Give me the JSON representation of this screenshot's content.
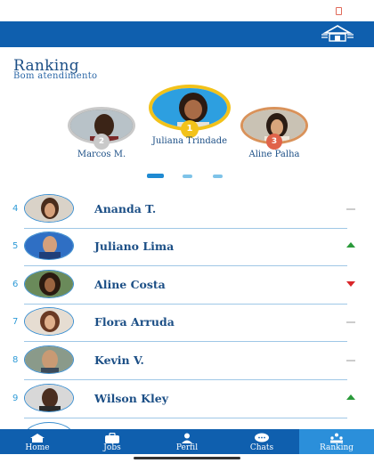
{
  "header": {
    "logo_icon": "house-logo-icon"
  },
  "ranking": {
    "title": "Ranking",
    "subtitle": "Bom atendimento"
  },
  "podium": [
    {
      "position": "2",
      "name": "Marcos M.",
      "medal": "silver-medal-icon"
    },
    {
      "position": "1",
      "name": "Juliana Trindade",
      "medal": "gold-medal-icon"
    },
    {
      "position": "3",
      "name": "Aline Palha",
      "medal": "bronze-medal-icon"
    }
  ],
  "pager": {
    "pages": 3,
    "active_index": 0
  },
  "list": [
    {
      "position": "4",
      "name": "Ananda T.",
      "trend": "neutral"
    },
    {
      "position": "5",
      "name": "Juliano Lima",
      "trend": "up"
    },
    {
      "position": "6",
      "name": "Aline Costa",
      "trend": "down"
    },
    {
      "position": "7",
      "name": "Flora Arruda",
      "trend": "neutral"
    },
    {
      "position": "8",
      "name": "Kevin V.",
      "trend": "neutral"
    },
    {
      "position": "9",
      "name": "Wilson Kley",
      "trend": "up"
    }
  ],
  "nav": [
    {
      "label": "Home",
      "icon": "home-icon",
      "active": false
    },
    {
      "label": "Jobs",
      "icon": "briefcase-icon",
      "active": false
    },
    {
      "label": "Perfil",
      "icon": "user-icon",
      "active": false
    },
    {
      "label": "Chats",
      "icon": "chat-icon",
      "active": false
    },
    {
      "label": "Ranking",
      "icon": "ranking-icon",
      "active": true
    }
  ],
  "colors": {
    "brand_blue": "#0f5fae",
    "active_tab": "#2b8fda",
    "title_text": "#1c4f86",
    "trend_up": "#2a9a3a",
    "trend_down": "#d9262a",
    "gold": "#f2c21a",
    "silver": "#c9c9c9",
    "bronze": "#d9925a"
  }
}
